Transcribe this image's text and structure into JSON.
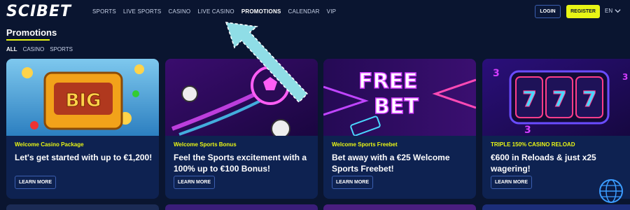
{
  "brand": {
    "logo": "SCIBET"
  },
  "nav": {
    "items": [
      {
        "label": "SPORTS",
        "active": false
      },
      {
        "label": "LIVE SPORTS",
        "active": false
      },
      {
        "label": "CASINO",
        "active": false
      },
      {
        "label": "LIVE CASINO",
        "active": false
      },
      {
        "label": "PROMOTIONS",
        "active": true
      },
      {
        "label": "CALENDAR",
        "active": false
      },
      {
        "label": "VIP",
        "active": false
      }
    ]
  },
  "auth": {
    "login": "LOGIN",
    "register": "REGISTER"
  },
  "lang": {
    "code": "EN"
  },
  "page": {
    "title": "Promotions"
  },
  "filters": [
    {
      "label": "ALL",
      "active": true
    },
    {
      "label": "CASINO",
      "active": false
    },
    {
      "label": "SPORTS",
      "active": false
    }
  ],
  "cards": [
    {
      "tag": "Welcome Casino Package",
      "title": "Let's get started with up to €1,200!",
      "button": "LEARN MORE",
      "image_text": "BIG"
    },
    {
      "tag": "Welcome Sports Bonus",
      "title": "Feel the Sports excitement with a 100% up to €100 Bonus!",
      "button": "LEARN MORE"
    },
    {
      "tag": "Welcome Sports Freebet",
      "title": "Bet away with a €25 Welcome Sports Freebet!",
      "button": "LEARN MORE",
      "image_text": "FREE BET"
    },
    {
      "tag": "TRIPLE 150% CASINO RELOAD",
      "title": "€600 in Reloads & just x25 wagering!",
      "button": "LEARN MORE",
      "image_text": "777"
    }
  ],
  "colors": {
    "background": "#0a1530",
    "card": "#0e2251",
    "accent": "#e8f515",
    "annotation_arrow": "#8fdde6"
  }
}
